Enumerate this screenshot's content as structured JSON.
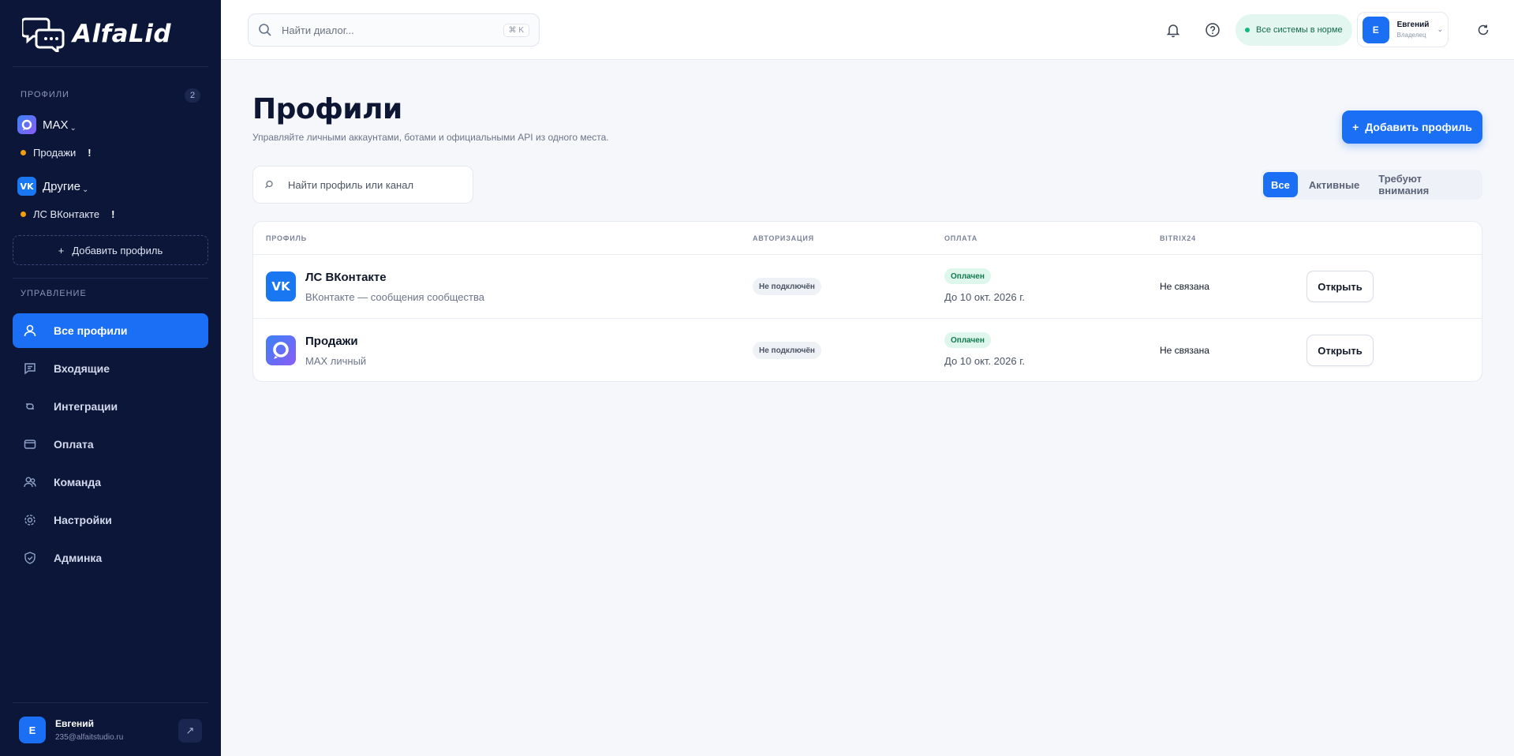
{
  "app": {
    "logo_text": "AlfaLid"
  },
  "sidebar": {
    "profiles_label": "ПРОФИЛИ",
    "profiles_count": "2",
    "groups": [
      {
        "title": "MAX",
        "icon": "max-icon",
        "items": [
          {
            "label": "Продажи",
            "warn": "!"
          }
        ]
      },
      {
        "title": "Другие",
        "icon": "vk-icon",
        "items": [
          {
            "label": "ЛС ВКонтакте",
            "warn": "!"
          }
        ]
      }
    ],
    "add_profile_label": "Добавить профиль",
    "manage_label": "УПРАВЛЕНИЕ",
    "nav": [
      {
        "label": "Все профили",
        "icon": "user-icon",
        "active": true
      },
      {
        "label": "Входящие",
        "icon": "inbox-icon"
      },
      {
        "label": "Интеграции",
        "icon": "integrations-icon"
      },
      {
        "label": "Оплата",
        "icon": "wallet-icon"
      },
      {
        "label": "Команда",
        "icon": "team-icon"
      },
      {
        "label": "Настройки",
        "icon": "gear-icon"
      },
      {
        "label": "Админка",
        "icon": "shield-icon"
      }
    ],
    "user": {
      "initial": "E",
      "name": "Евгений",
      "email": "235@alfaitstudio.ru"
    }
  },
  "topbar": {
    "search_placeholder": "Найти диалог...",
    "search_shortcut": "⌘ K",
    "status_text": "Все системы в норме",
    "user": {
      "initial": "E",
      "name": "Евгений",
      "role": "Владелец"
    }
  },
  "main": {
    "title": "Профили",
    "subtitle": "Управляйте личными аккаунтами, ботами и официальными API из одного места.",
    "add_button": "Добавить профиль",
    "search_placeholder": "Найти профиль или канал",
    "filters": [
      "Все",
      "Активные",
      "Требуют внимания"
    ],
    "table": {
      "headers": [
        "ПРОФИЛЬ",
        "АВТОРИЗАЦИЯ",
        "ОПЛАТА",
        "BITRIX24"
      ],
      "rows": [
        {
          "name": "ЛС ВКонтакте",
          "subtitle": "ВКонтакте — сообщения сообщества",
          "icon": "vk-icon",
          "auth": "Не подключён",
          "payment_status": "Оплачен",
          "payment_date": "До 10 окт. 2026 г.",
          "bitrix": "Не связана",
          "action": "Открыть"
        },
        {
          "name": "Продажи",
          "subtitle": "MAX личный",
          "icon": "max-icon",
          "auth": "Не подключён",
          "payment_status": "Оплачен",
          "payment_date": "До 10 окт. 2026 г.",
          "bitrix": "Не связана",
          "action": "Открыть"
        }
      ]
    }
  },
  "colors": {
    "accent": "#1a6ff5",
    "sidebar_bg": "#0b1638",
    "warning_dot": "#f59e0b",
    "success": "#10b981"
  }
}
